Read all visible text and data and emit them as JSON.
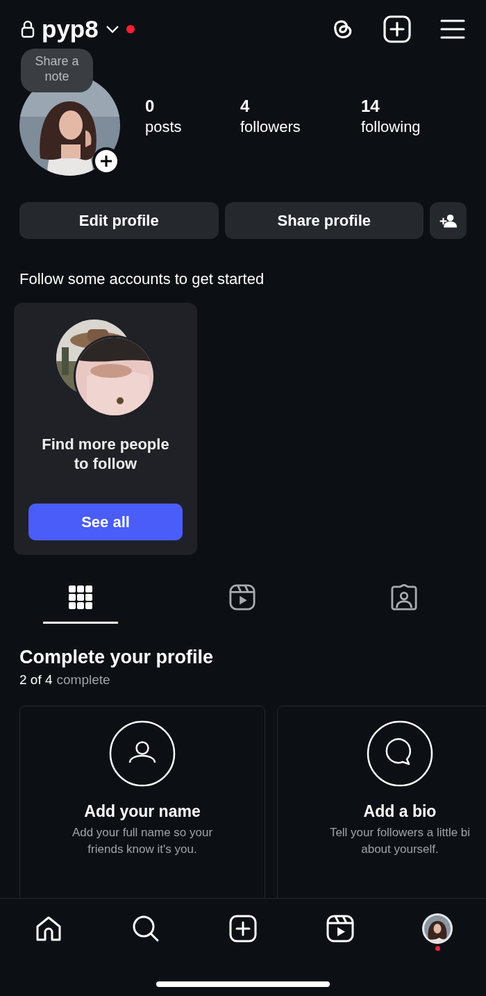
{
  "header": {
    "username": "pyp8",
    "unread": true
  },
  "note": {
    "text": "Share a note"
  },
  "stats": [
    {
      "value": "0",
      "label": "posts"
    },
    {
      "value": "4",
      "label": "followers"
    },
    {
      "value": "14",
      "label": "following"
    }
  ],
  "buttons": [
    "Edit profile",
    "Share profile"
  ],
  "suggestions": {
    "heading": "Follow some accounts to get started",
    "title": "Find more people to follow",
    "button": "See all"
  },
  "tabs": [
    {
      "kind": "grid",
      "selected": true
    },
    {
      "kind": "reels",
      "selected": false
    },
    {
      "kind": "tagged",
      "selected": false
    }
  ],
  "complete": {
    "title": "Complete your profile",
    "count": "2 of 4",
    "suffix": "complete"
  },
  "cards": [
    {
      "kind": "name",
      "title": "Add your name",
      "lines": [
        "Add your full name so your",
        "friends know it's you."
      ]
    },
    {
      "kind": "bio",
      "title": "Add a bio",
      "lines": [
        "Tell your followers a little bi",
        "about yourself."
      ]
    }
  ],
  "bottom_nav": [
    {
      "kind": "home",
      "selected": false,
      "unread": false
    },
    {
      "kind": "search",
      "selected": false,
      "unread": false
    },
    {
      "kind": "create",
      "selected": false,
      "unread": false
    },
    {
      "kind": "reels",
      "selected": false,
      "unread": false
    },
    {
      "kind": "profile",
      "selected": true,
      "unread": true
    }
  ]
}
